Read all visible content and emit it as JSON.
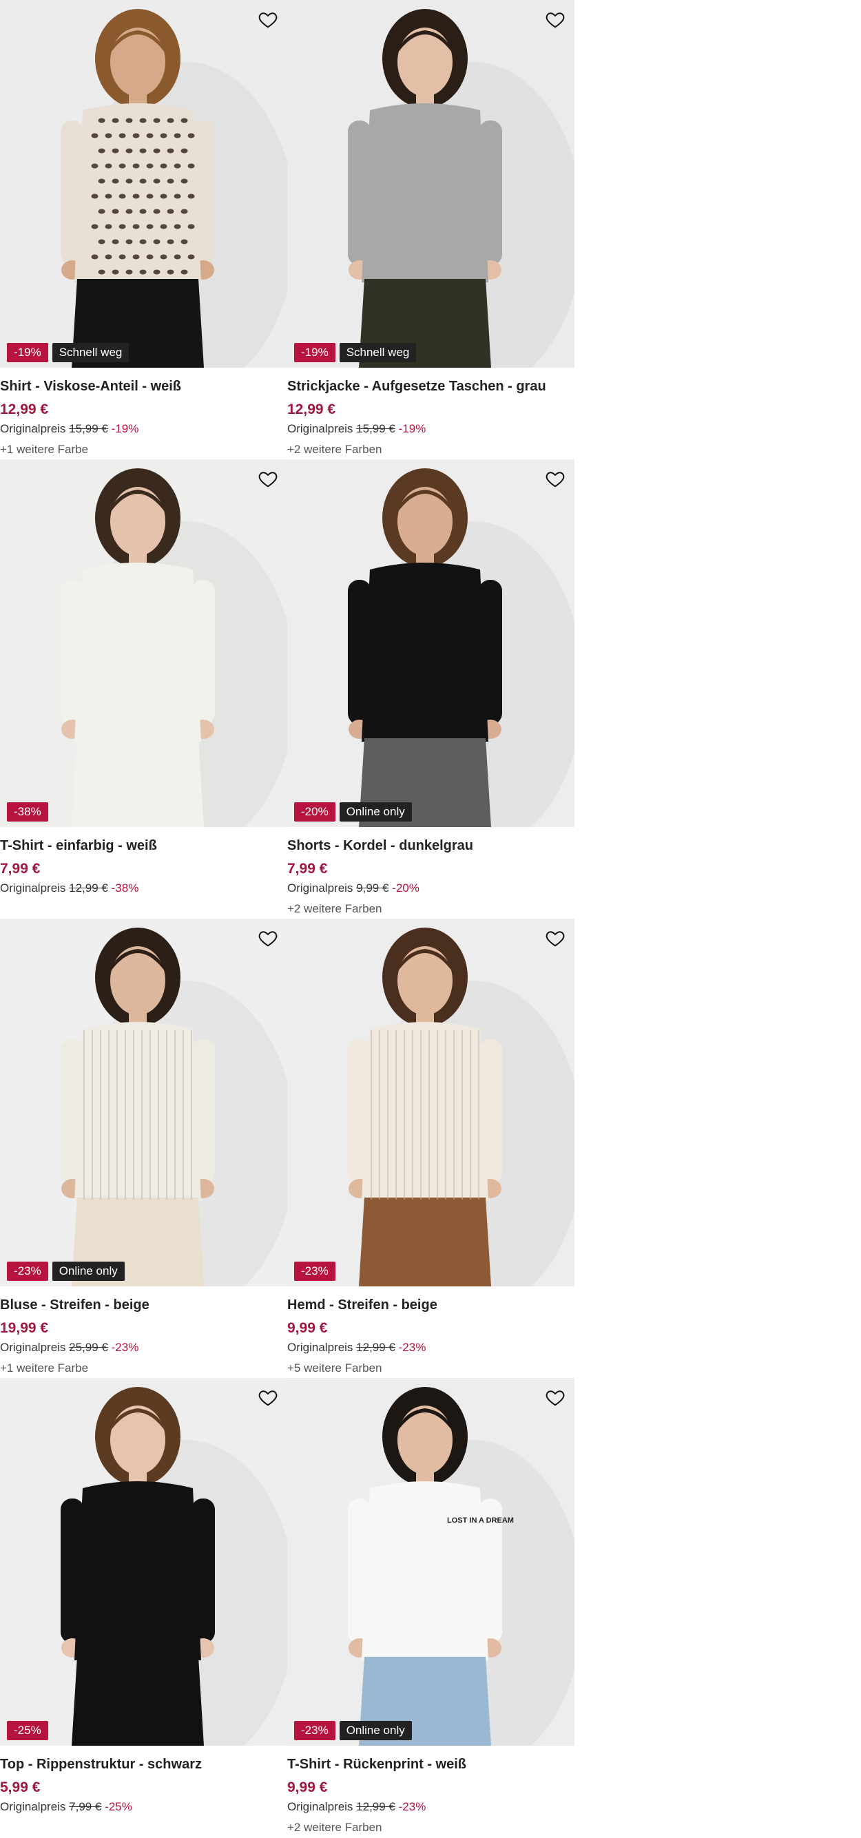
{
  "products": [
    {
      "title": "Shirt - Viskose-Anteil - weiß",
      "price": "12,99 €",
      "orig_label": "Originalpreis",
      "orig_price": "15,99 €",
      "orig_pct": "-19%",
      "badge_disc": "-19%",
      "badge_tag": "Schnell weg",
      "more": "+1 weitere Farbe",
      "bg": "#ececec",
      "top_color": "#e8e0d4",
      "bottom_color": "#141414",
      "hair_color": "#8a5a2e",
      "skin": "#d6a98a",
      "pattern": "leopard"
    },
    {
      "title": "Strickjacke - Aufgesetze Taschen - grau",
      "price": "12,99 €",
      "orig_label": "Originalpreis",
      "orig_price": "15,99 €",
      "orig_pct": "-19%",
      "badge_disc": "-19%",
      "badge_tag": "Schnell weg",
      "more": "+2 weitere Farben",
      "bg": "#ebebeb",
      "top_color": "#a8a8a8",
      "bottom_color": "#2f3326",
      "hair_color": "#2a1e16",
      "skin": "#e2bfa6",
      "pattern": "none"
    },
    {
      "title": "T-Shirt - einfarbig - weiß",
      "price": "7,99 €",
      "orig_label": "Originalpreis",
      "orig_price": "12,99 €",
      "orig_pct": "-38%",
      "badge_disc": "-38%",
      "badge_tag": "",
      "more": "",
      "bg": "#eeeeec",
      "top_color": "#f1f2ec",
      "bottom_color": "#f1f2ec",
      "hair_color": "#3a2a1e",
      "skin": "#e4c2ab",
      "pattern": "none"
    },
    {
      "title": "Shorts - Kordel - dunkelgrau",
      "price": "7,99 €",
      "orig_label": "Originalpreis",
      "orig_price": "9,99 €",
      "orig_pct": "-20%",
      "badge_disc": "-20%",
      "badge_tag": "Online only",
      "more": "+2 weitere Farben",
      "bg": "#ededed",
      "top_color": "#121212",
      "bottom_color": "#5e5e60",
      "hair_color": "#5a3a22",
      "skin": "#d9ad92",
      "pattern": "none"
    },
    {
      "title": "Bluse - Streifen - beige",
      "price": "19,99 €",
      "orig_label": "Originalpreis",
      "orig_price": "25,99 €",
      "orig_pct": "-23%",
      "badge_disc": "-23%",
      "badge_tag": "Online only",
      "more": "+1 weitere Farbe",
      "bg": "#efefef",
      "top_color": "#eeebe2",
      "bottom_color": "#e9dfcf",
      "hair_color": "#2b1f17",
      "skin": "#ddb79c",
      "pattern": "stripes"
    },
    {
      "title": "Hemd - Streifen - beige",
      "price": "9,99 €",
      "orig_label": "Originalpreis",
      "orig_price": "12,99 €",
      "orig_pct": "-23%",
      "badge_disc": "-23%",
      "badge_tag": "",
      "more": "+5 weitere Farben",
      "bg": "#ededed",
      "top_color": "#efe9df",
      "bottom_color": "#8c5a35",
      "hair_color": "#4a2f1e",
      "skin": "#e0b89c",
      "pattern": "stripes"
    },
    {
      "title": "Top - Rippenstruktur - schwarz",
      "price": "5,99 €",
      "orig_label": "Originalpreis",
      "orig_price": "7,99 €",
      "orig_pct": "-25%",
      "badge_disc": "-25%",
      "badge_tag": "",
      "more": "",
      "bg": "#eeeeee",
      "top_color": "#111111",
      "bottom_color": "#111111",
      "hair_color": "#5b3b22",
      "skin": "#e6c4ad",
      "pattern": "none"
    },
    {
      "title": "T-Shirt - Rückenprint - weiß",
      "price": "9,99 €",
      "orig_label": "Originalpreis",
      "orig_price": "12,99 €",
      "orig_pct": "-23%",
      "badge_disc": "-23%",
      "badge_tag": "Online only",
      "more": "+2 weitere Farben",
      "bg": "#ededed",
      "top_color": "#f7f7f5",
      "bottom_color": "#9bb8d3",
      "hair_color": "#1d1714",
      "skin": "#e1bca3",
      "pattern": "print",
      "print_text": "LOST IN A DREAM"
    }
  ],
  "icons": {
    "wishlist": "heart-outline-icon"
  },
  "colors": {
    "discount": "#b8123e",
    "price": "#a0183f",
    "tag": "#222222"
  }
}
